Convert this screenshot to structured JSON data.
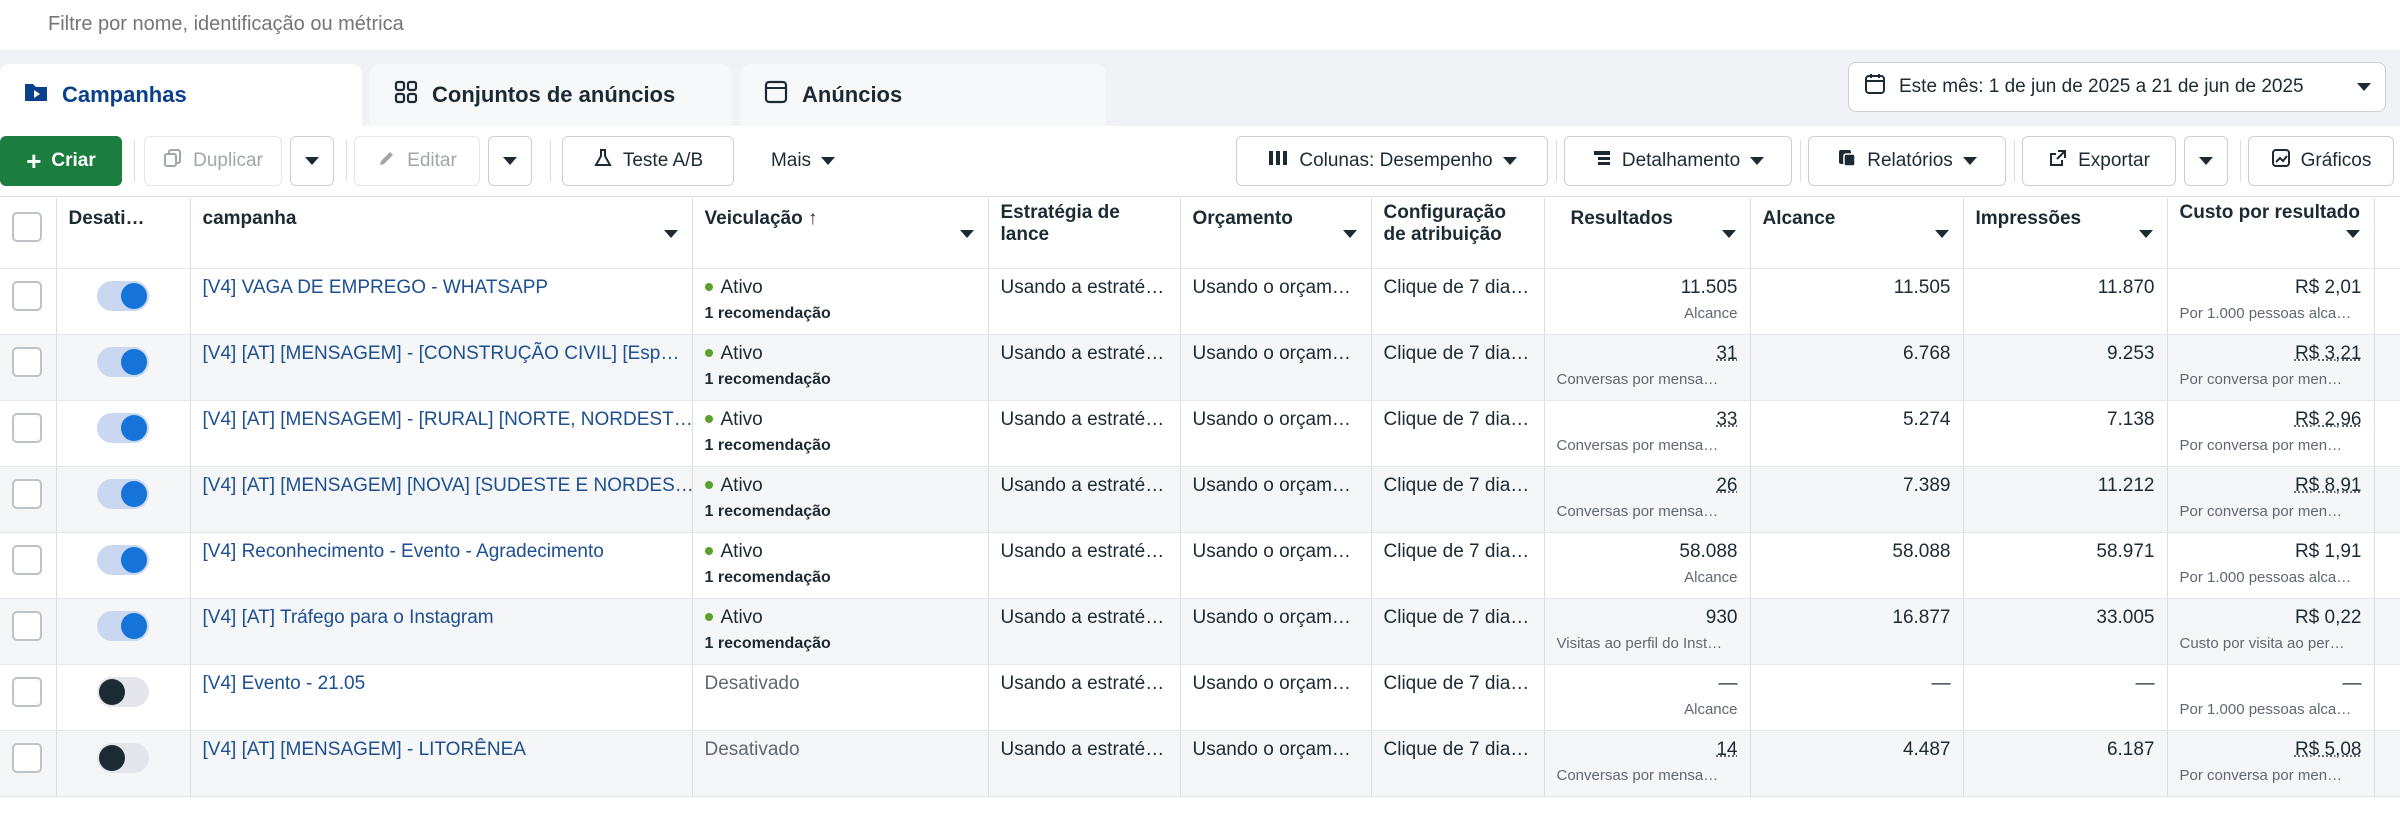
{
  "filter": {
    "placeholder": "Filtre por nome, identificação ou métrica"
  },
  "tabs": [
    {
      "label": "Campanhas",
      "icon": "folder-icon",
      "active": true
    },
    {
      "label": "Conjuntos de anúncios",
      "icon": "grid-icon",
      "active": false
    },
    {
      "label": "Anúncios",
      "icon": "ad-icon",
      "active": false
    }
  ],
  "date_range": {
    "label": "Este mês: 1 de jun de 2025 a 21 de jun de 2025"
  },
  "toolbar": {
    "create": "Criar",
    "duplicate": "Duplicar",
    "edit": "Editar",
    "ab_test": "Teste A/B",
    "more": "Mais",
    "columns": "Colunas: Desempenho",
    "breakdown": "Detalhamento",
    "reports": "Relatórios",
    "export": "Exportar",
    "charts": "Gráficos"
  },
  "columns": {
    "toggle": "Desati…",
    "campaign": "campanha",
    "delivery": "Veiculação ↑",
    "bid": "Estratégia de lance",
    "budget": "Orçamento",
    "attribution": "Configuração de atribuição",
    "results": "Resultados",
    "reach": "Alcance",
    "impressions": "Impressões",
    "cpr": "Custo por resultado"
  },
  "rows": [
    {
      "on": true,
      "name": "[V4] VAGA DE EMPREGO - WHATSAPP",
      "status": "Ativo",
      "rec": "1 recomendação",
      "bid": "Usando a estraté…",
      "budget": "Usando o orçam…",
      "attr": "Clique de 7 dia…",
      "results": "11.505",
      "results_sub": "Alcance",
      "reach": "11.505",
      "impr": "11.870",
      "cpr": "R$ 2,01",
      "cpr_sub": "Por 1.000 pessoas alca…"
    },
    {
      "on": true,
      "name": "[V4] [AT] [MENSAGEM] - [CONSTRUÇÃO CIVIL] [Esp…",
      "status": "Ativo",
      "rec": "1 recomendação",
      "bid": "Usando a estraté…",
      "budget": "Usando o orçam…",
      "attr": "Clique de 7 dia…",
      "results": "31",
      "results_sub": "Conversas por mensa…",
      "reach": "6.768",
      "impr": "9.253",
      "cpr": "R$ 3,21",
      "cpr_sub": "Por conversa por men…"
    },
    {
      "on": true,
      "name": "[V4] [AT] [MENSAGEM] - [RURAL] [NORTE, NORDEST…",
      "status": "Ativo",
      "rec": "1 recomendação",
      "bid": "Usando a estraté…",
      "budget": "Usando o orçam…",
      "attr": "Clique de 7 dia…",
      "results": "33",
      "results_sub": "Conversas por mensa…",
      "reach": "5.274",
      "impr": "7.138",
      "cpr": "R$ 2,96",
      "cpr_sub": "Por conversa por men…"
    },
    {
      "on": true,
      "name": "[V4] [AT] [MENSAGEM] [NOVA] [SUDESTE E NORDES…",
      "status": "Ativo",
      "rec": "1 recomendação",
      "bid": "Usando a estraté…",
      "budget": "Usando o orçam…",
      "attr": "Clique de 7 dia…",
      "results": "26",
      "results_sub": "Conversas por mensa…",
      "reach": "7.389",
      "impr": "11.212",
      "cpr": "R$ 8,91",
      "cpr_sub": "Por conversa por men…"
    },
    {
      "on": true,
      "name": "[V4] Reconhecimento - Evento - Agradecimento",
      "status": "Ativo",
      "rec": "1 recomendação",
      "bid": "Usando a estraté…",
      "budget": "Usando o orçam…",
      "attr": "Clique de 7 dia…",
      "results": "58.088",
      "results_sub": "Alcance",
      "reach": "58.088",
      "impr": "58.971",
      "cpr": "R$ 1,91",
      "cpr_sub": "Por 1.000 pessoas alca…"
    },
    {
      "on": true,
      "name": "[V4] [AT] Tráfego para o Instagram",
      "status": "Ativo",
      "rec": "1 recomendação",
      "bid": "Usando a estraté…",
      "budget": "Usando o orçam…",
      "attr": "Clique de 7 dia…",
      "results": "930",
      "results_sub": "Visitas ao perfil do Inst…",
      "reach": "16.877",
      "impr": "33.005",
      "cpr": "R$ 0,22",
      "cpr_sub": "Custo por visita ao per…"
    },
    {
      "on": false,
      "name": "[V4] Evento - 21.05",
      "status": "Desativado",
      "rec": "",
      "bid": "Usando a estraté…",
      "budget": "Usando o orçam…",
      "attr": "Clique de 7 dia…",
      "results": "—",
      "results_sub": "Alcance",
      "reach": "—",
      "impr": "—",
      "cpr": "—",
      "cpr_sub": "Por 1.000 pessoas alca…"
    },
    {
      "on": false,
      "name": "[V4] [AT] [MENSAGEM] - LITORÊNEA",
      "status": "Desativado",
      "rec": "",
      "bid": "Usando a estraté…",
      "budget": "Usando o orçam…",
      "attr": "Clique de 7 dia…",
      "results": "14",
      "results_sub": "Conversas por mensa…",
      "reach": "4.487",
      "impr": "6.187",
      "cpr": "R$ 5,08",
      "cpr_sub": "Por conversa por men…"
    }
  ]
}
